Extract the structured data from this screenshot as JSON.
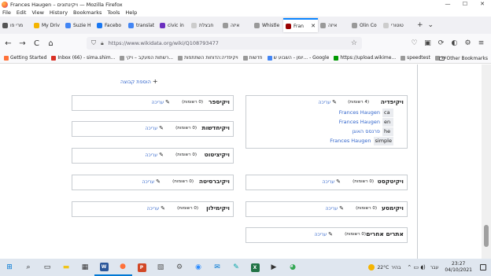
{
  "window": {
    "title": "Frances Haugen – ויקינתונים — Mozilla Firefox",
    "controls": [
      "—",
      "☐",
      "✕"
    ]
  },
  "menu": [
    "File",
    "Edit",
    "View",
    "History",
    "Bookmarks",
    "Tools",
    "Help"
  ],
  "tabs": [
    {
      "label": "מרי פו",
      "color": "#555555"
    },
    {
      "label": "My Driv",
      "color": "#f4b400"
    },
    {
      "label": "Suzie H",
      "color": "#4285f4"
    },
    {
      "label": "Facebo",
      "color": "#1877f2"
    },
    {
      "label": "translat",
      "color": "#4285f4"
    },
    {
      "label": "civic in",
      "color": "#6b2fbf"
    },
    {
      "label": "חבצלת",
      "color": "#cccccc"
    },
    {
      "label": "איזה",
      "color": "#999999"
    },
    {
      "label": "Whistle",
      "color": "#999999"
    },
    {
      "label": "Fran",
      "color": "#990000",
      "active": true
    },
    {
      "label": "איזה",
      "color": "#999999"
    },
    {
      "label": "Olin Co",
      "color": "#999999"
    },
    {
      "label": "טוטורי",
      "color": "#cccccc"
    }
  ],
  "tab_extras": [
    "+",
    "⌄"
  ],
  "nav": {
    "back": "←",
    "forward": "→",
    "reload": "C",
    "home": "⌂",
    "url": "https://www.wikidata.org/wiki/Q108793477",
    "star": "☆",
    "right_icons": [
      "♡",
      "▣",
      "⟳",
      "◐",
      "⚙",
      "≡"
    ]
  },
  "bookmarks": [
    {
      "label": "Getting Started",
      "color": "#ff7139"
    },
    {
      "label": "Inbox (66) - sima.shim...",
      "color": "#d93025"
    },
    {
      "label": "רשתות המעקב – ויקי...",
      "color": "#999999"
    },
    {
      "label": "ויקיפדיה:הדוחות השתתפות",
      "color": "#999999"
    },
    {
      "label": "חדשות",
      "color": "#999999"
    },
    {
      "label": "יומן - השבוע ש... - Google",
      "color": "#4285f4"
    },
    {
      "label": "https://upload.wikime...",
      "color": "#009900"
    },
    {
      "label": "speedtest",
      "color": "#999999"
    },
    {
      "label": "אנ",
      "color": "#999999"
    }
  ],
  "other_bookmarks": "Other Bookmarks",
  "page": {
    "add_category": "הוספת קבוצה",
    "edit_label": "עריכה",
    "groups": [
      {
        "name": "ויקיפדיה",
        "count": "(4 רשומות)"
      },
      {
        "name": "ויקיספר",
        "count": "(0 רשומות)"
      },
      {
        "name": "ויקיחדשות",
        "count": "(0 רשומות)"
      },
      {
        "name": "ויקיציטוט",
        "count": "(0 רשומות)"
      },
      {
        "name": "ויקיברסיטה",
        "count": "(0 רשומות)"
      },
      {
        "name": "ויקיטקסט",
        "count": "(0 רשומות)"
      },
      {
        "name": "ויקימילון",
        "count": "(0 רשומות)"
      },
      {
        "name": "ויקימסע",
        "count": "(0 רשומות)"
      },
      {
        "name": "אתרים אחרים",
        "count": "(0 רשומות)"
      }
    ],
    "sitelinks": [
      {
        "title": "Frances Haugen",
        "code": "ca"
      },
      {
        "title": "Frances Haugen",
        "code": "en"
      },
      {
        "title": "פרנסס האוגן",
        "code": "he"
      },
      {
        "title": "Frances Haugen",
        "code": "simple"
      }
    ]
  },
  "taskbar": {
    "apps": [
      {
        "name": "windows",
        "glyph": "⊞",
        "color": "#0078d4"
      },
      {
        "name": "search",
        "glyph": "⌕",
        "color": "#222222"
      },
      {
        "name": "task-view",
        "glyph": "▭",
        "color": "#222222"
      },
      {
        "name": "file-explorer",
        "glyph": "▬",
        "color": "#f0c419"
      },
      {
        "name": "store",
        "glyph": "▦",
        "color": "#333333"
      },
      {
        "name": "word",
        "glyph": "W",
        "color": "#2b579a"
      },
      {
        "name": "firefox",
        "glyph": "●",
        "color": "#ff7139"
      },
      {
        "name": "powerpoint",
        "glyph": "P",
        "color": "#d24726"
      },
      {
        "name": "photos",
        "glyph": "▧",
        "color": "#555555"
      },
      {
        "name": "settings",
        "glyph": "⚙",
        "color": "#555555"
      },
      {
        "name": "zoom",
        "glyph": "◉",
        "color": "#2d8cff"
      },
      {
        "name": "mail",
        "glyph": "✉",
        "color": "#0078d4"
      },
      {
        "name": "paint",
        "glyph": "✎",
        "color": "#00a4a6"
      },
      {
        "name": "excel",
        "glyph": "X",
        "color": "#217346"
      },
      {
        "name": "media",
        "glyph": "▶",
        "color": "#333333"
      },
      {
        "name": "chrome",
        "glyph": "◕",
        "color": "#34a853"
      }
    ],
    "weather": "22°C",
    "weather_text": "בהיר",
    "language": "עבר",
    "time": "23:27",
    "date": "04/10/2021"
  }
}
